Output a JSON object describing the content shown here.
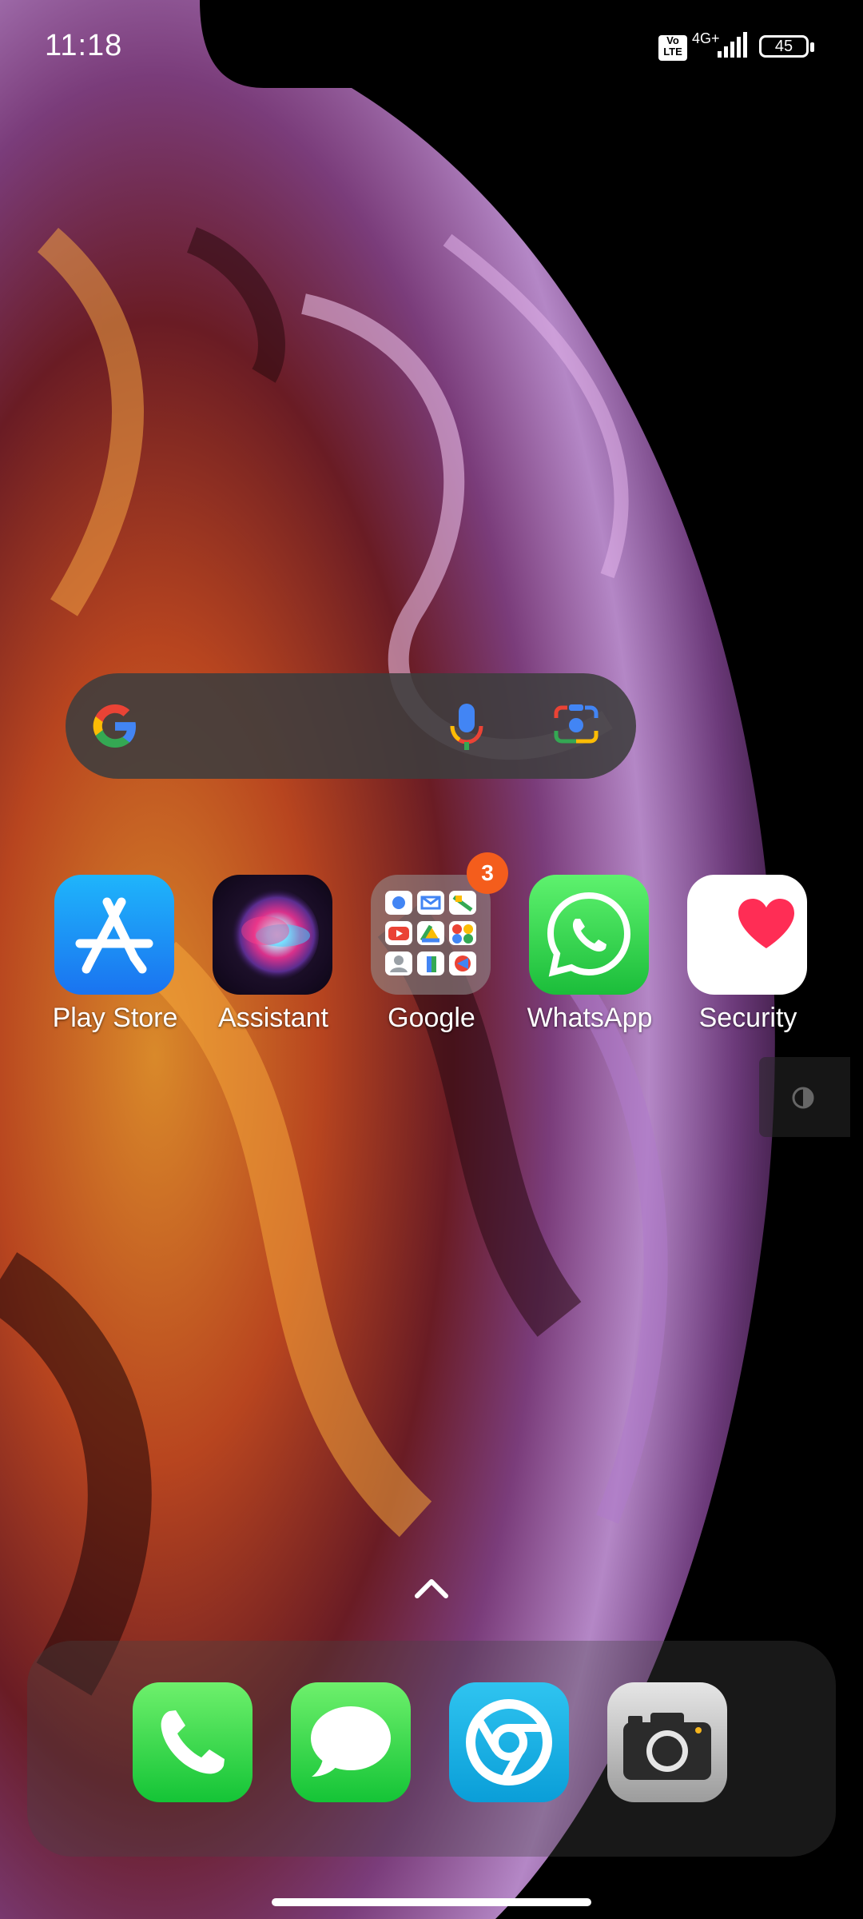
{
  "status_bar": {
    "time": "11:18",
    "volte": "Vo\nLTE",
    "network": "4G+",
    "battery": "45"
  },
  "search_bar": {
    "icons": [
      "google-g-icon",
      "microphone-icon",
      "google-lens-icon"
    ]
  },
  "apps": [
    {
      "label": "Play Store",
      "icon": "app-store-icon"
    },
    {
      "label": "Assistant",
      "icon": "siri-assistant-icon"
    },
    {
      "label": "Google",
      "icon": "google-folder-icon",
      "badge": "3"
    },
    {
      "label": "WhatsApp",
      "icon": "whatsapp-icon"
    },
    {
      "label": "Security",
      "icon": "health-heart-icon"
    }
  ],
  "dock": [
    {
      "icon": "phone-icon"
    },
    {
      "icon": "messages-icon"
    },
    {
      "icon": "browser-icon"
    },
    {
      "icon": "camera-icon"
    }
  ],
  "colors": {
    "badge": "#f45d1c",
    "whatsapp_green": "#25d366",
    "app_store_blue": "#1a8cf6",
    "messages_green": "#2bd94a"
  }
}
